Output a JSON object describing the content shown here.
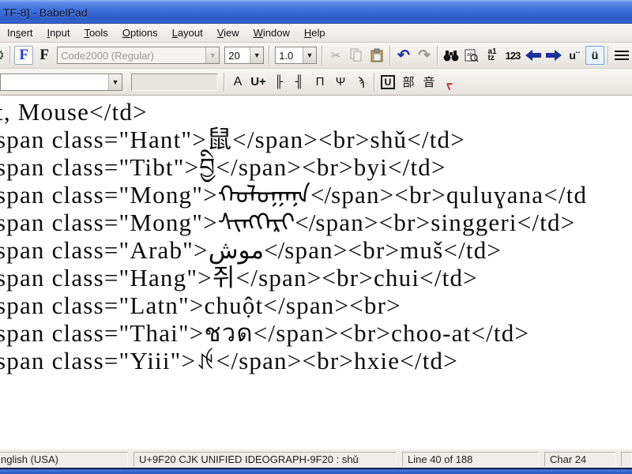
{
  "window": {
    "title": "TF-8] - BabelPad"
  },
  "menu": {
    "items": [
      {
        "pre": "In",
        "key": "s",
        "post": "ert"
      },
      {
        "pre": "",
        "key": "I",
        "post": "nput"
      },
      {
        "pre": "",
        "key": "T",
        "post": "ools"
      },
      {
        "pre": "",
        "key": "O",
        "post": "ptions"
      },
      {
        "pre": "",
        "key": "L",
        "post": "ayout"
      },
      {
        "pre": "",
        "key": "V",
        "post": "iew"
      },
      {
        "pre": "",
        "key": "W",
        "post": "indow"
      },
      {
        "pre": "",
        "key": "H",
        "post": "elp"
      }
    ]
  },
  "toolbar": {
    "gear_icon": "⚙",
    "font_toggle_blue": "F",
    "font_toggle_black": "F",
    "font_name": "Code2000 (Regular)",
    "font_size": "20",
    "zoom_level": "1.0",
    "cut_icon": "✂",
    "undo_icon": "↶",
    "redo_icon": "↷",
    "az_top": "a1",
    "az_bottom": "tz",
    "numbers_label": "123",
    "u_plain_label": "u¨",
    "u_composed_label": "ü"
  },
  "toolbar2": {
    "char_label": "A",
    "codepoint_label": "U+",
    "glyph_buttons": [
      "╟",
      "╢",
      "Π",
      "Ψ",
      "ϡ"
    ],
    "boxed_u_label": "U",
    "radical_label": "部",
    "pinyin_label": "音",
    "mongolian_red_label": "ᠵ"
  },
  "editor": {
    "lines": [
      "t, Mouse</td>",
      "span class=\"Hant\">鼠</span><br>shǔ</td>",
      "span class=\"Tibt\">བྱི</span><br>byi</td>",
      "span class=\"Mong\">ᠬᠤᠯᠤᠭᠠᠨᠠ</span><br>quluɣana</td",
      "span class=\"Mong\">ᠰᠢᠩᠭᠡᠷᠢ</span><br>singgeri</td>",
      "span class=\"Arab\">موش</span><br>muš</td>",
      "span class=\"Hang\">쥐</span><br>chui</td>",
      "span class=\"Latn\">chuột</span><br>",
      "span class=\"Thai\">ชวด</span><br>choo-at</td>",
      "span class=\"Yiii\">ꉌ</span><br>hxie</td>"
    ]
  },
  "statusbar": {
    "language": "nglish (USA)",
    "char_info": "U+9F20 CJK UNIFIED IDEOGRAPH-9F20 : shǔ",
    "line_info": "Line 40 of 188",
    "char_pos": "Char 24"
  },
  "colors": {
    "titlebar_blue": "#3c6fdb",
    "arrow_navy": "#1b2f9d",
    "taskbar_blue": "#3466cf",
    "disabled_gray": "#a9a59e"
  }
}
